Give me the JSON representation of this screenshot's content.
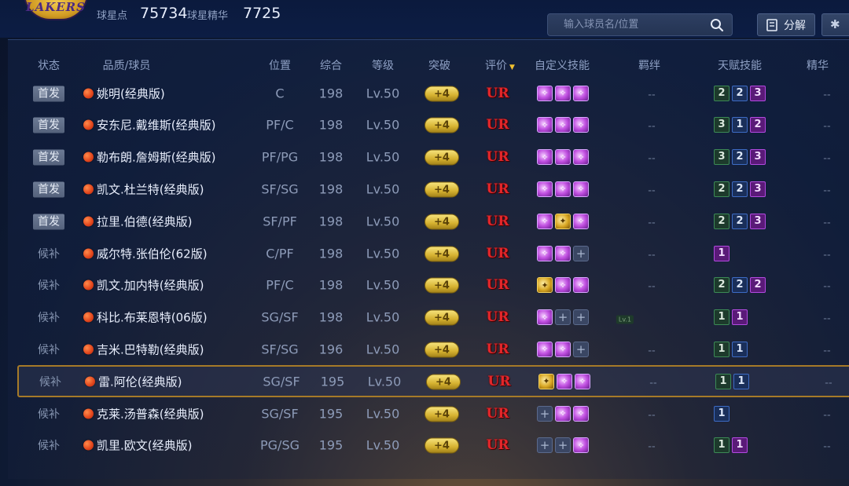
{
  "header": {
    "logo_text": "LAKERS",
    "star_points_label": "球星点",
    "star_points_value": "75734",
    "star_essence_label": "球星精华",
    "star_essence_value": "7725",
    "search_placeholder": "输入球员名/位置",
    "decompose_label": "分解",
    "more_label": "✱"
  },
  "columns": {
    "status": "状态",
    "player": "品质/球员",
    "position": "位置",
    "overall": "综合",
    "level": "等级",
    "breakthrough": "突破",
    "rating": "评价",
    "custom_skills": "自定义技能",
    "bonds": "羁绊",
    "talents": "天赋技能",
    "essence": "精华"
  },
  "rows": [
    {
      "status": "首发",
      "starter": true,
      "name": "姚明(经典版)",
      "position": "C",
      "overall": "198",
      "level": "Lv.50",
      "breakthrough": "+4",
      "rating": "UR",
      "skills": [
        "purple",
        "purple",
        "purple"
      ],
      "bond": "--",
      "talents": [
        [
          "2",
          "green"
        ],
        [
          "2",
          "blue"
        ],
        [
          "3",
          "purple"
        ]
      ],
      "essence": "--"
    },
    {
      "status": "首发",
      "starter": true,
      "name": "安东尼.戴维斯(经典版)",
      "position": "PF/C",
      "overall": "198",
      "level": "Lv.50",
      "breakthrough": "+4",
      "rating": "UR",
      "skills": [
        "purple",
        "purple",
        "purple"
      ],
      "bond": "--",
      "talents": [
        [
          "3",
          "green"
        ],
        [
          "1",
          "blue"
        ],
        [
          "2",
          "purple"
        ]
      ],
      "essence": "--"
    },
    {
      "status": "首发",
      "starter": true,
      "name": "勒布朗.詹姆斯(经典版)",
      "position": "PF/PG",
      "overall": "198",
      "level": "Lv.50",
      "breakthrough": "+4",
      "rating": "UR",
      "skills": [
        "purple",
        "purple",
        "purple"
      ],
      "bond": "--",
      "talents": [
        [
          "3",
          "green"
        ],
        [
          "2",
          "blue"
        ],
        [
          "3",
          "purple"
        ]
      ],
      "essence": "--"
    },
    {
      "status": "首发",
      "starter": true,
      "name": "凯文.杜兰特(经典版)",
      "position": "SF/SG",
      "overall": "198",
      "level": "Lv.50",
      "breakthrough": "+4",
      "rating": "UR",
      "skills": [
        "purple",
        "purple",
        "purple"
      ],
      "bond": "--",
      "talents": [
        [
          "2",
          "green"
        ],
        [
          "2",
          "blue"
        ],
        [
          "3",
          "purple"
        ]
      ],
      "essence": "--"
    },
    {
      "status": "首发",
      "starter": true,
      "name": "拉里.伯德(经典版)",
      "position": "SF/PF",
      "overall": "198",
      "level": "Lv.50",
      "breakthrough": "+4",
      "rating": "UR",
      "skills": [
        "purple",
        "gold",
        "purple"
      ],
      "bond": "--",
      "talents": [
        [
          "2",
          "green"
        ],
        [
          "2",
          "blue"
        ],
        [
          "3",
          "purple"
        ]
      ],
      "essence": "--"
    },
    {
      "status": "候补",
      "starter": false,
      "name": "威尔特.张伯伦(62版)",
      "position": "C/PF",
      "overall": "198",
      "level": "Lv.50",
      "breakthrough": "+4",
      "rating": "UR",
      "skills": [
        "purple",
        "purple",
        "empty"
      ],
      "bond": "--",
      "talents": [
        [
          "1",
          "purple"
        ]
      ],
      "essence": "--"
    },
    {
      "status": "候补",
      "starter": false,
      "name": "凯文.加内特(经典版)",
      "position": "PF/C",
      "overall": "198",
      "level": "Lv.50",
      "breakthrough": "+4",
      "rating": "UR",
      "skills": [
        "gold",
        "purple",
        "purple"
      ],
      "bond": "--",
      "talents": [
        [
          "2",
          "green"
        ],
        [
          "2",
          "blue"
        ],
        [
          "2",
          "purple"
        ]
      ],
      "essence": "--"
    },
    {
      "status": "候补",
      "starter": false,
      "name": "科比.布莱恩特(06版)",
      "position": "SG/SF",
      "overall": "198",
      "level": "Lv.50",
      "breakthrough": "+4",
      "rating": "UR",
      "skills": [
        "purple",
        "empty",
        "empty"
      ],
      "bond": "Lv.1",
      "talents": [
        [
          "1",
          "green"
        ],
        [
          "1",
          "purple"
        ]
      ],
      "essence": "--"
    },
    {
      "status": "候补",
      "starter": false,
      "name": "吉米.巴特勒(经典版)",
      "position": "SF/SG",
      "overall": "196",
      "level": "Lv.50",
      "breakthrough": "+4",
      "rating": "UR",
      "skills": [
        "purple",
        "purple",
        "empty"
      ],
      "bond": "--",
      "talents": [
        [
          "1",
          "green"
        ],
        [
          "1",
          "blue"
        ]
      ],
      "essence": "--"
    },
    {
      "status": "候补",
      "starter": false,
      "selected": true,
      "name": "雷.阿伦(经典版)",
      "position": "SG/SF",
      "overall": "195",
      "level": "Lv.50",
      "breakthrough": "+4",
      "rating": "UR",
      "skills": [
        "gold",
        "purple",
        "purple"
      ],
      "bond": "--",
      "talents": [
        [
          "1",
          "green"
        ],
        [
          "1",
          "blue"
        ]
      ],
      "essence": "--"
    },
    {
      "status": "候补",
      "starter": false,
      "name": "克莱.汤普森(经典版)",
      "position": "SG/SF",
      "overall": "195",
      "level": "Lv.50",
      "breakthrough": "+4",
      "rating": "UR",
      "skills": [
        "empty",
        "purple",
        "purple"
      ],
      "bond": "--",
      "talents": [
        [
          "1",
          "blue"
        ]
      ],
      "essence": "--"
    },
    {
      "status": "候补",
      "starter": false,
      "name": "凯里.欧文(经典版)",
      "position": "PG/SG",
      "overall": "195",
      "level": "Lv.50",
      "breakthrough": "+4",
      "rating": "UR",
      "skills": [
        "empty",
        "empty",
        "purple"
      ],
      "bond": "--",
      "talents": [
        [
          "1",
          "green"
        ],
        [
          "1",
          "purple"
        ]
      ],
      "essence": "--"
    }
  ]
}
